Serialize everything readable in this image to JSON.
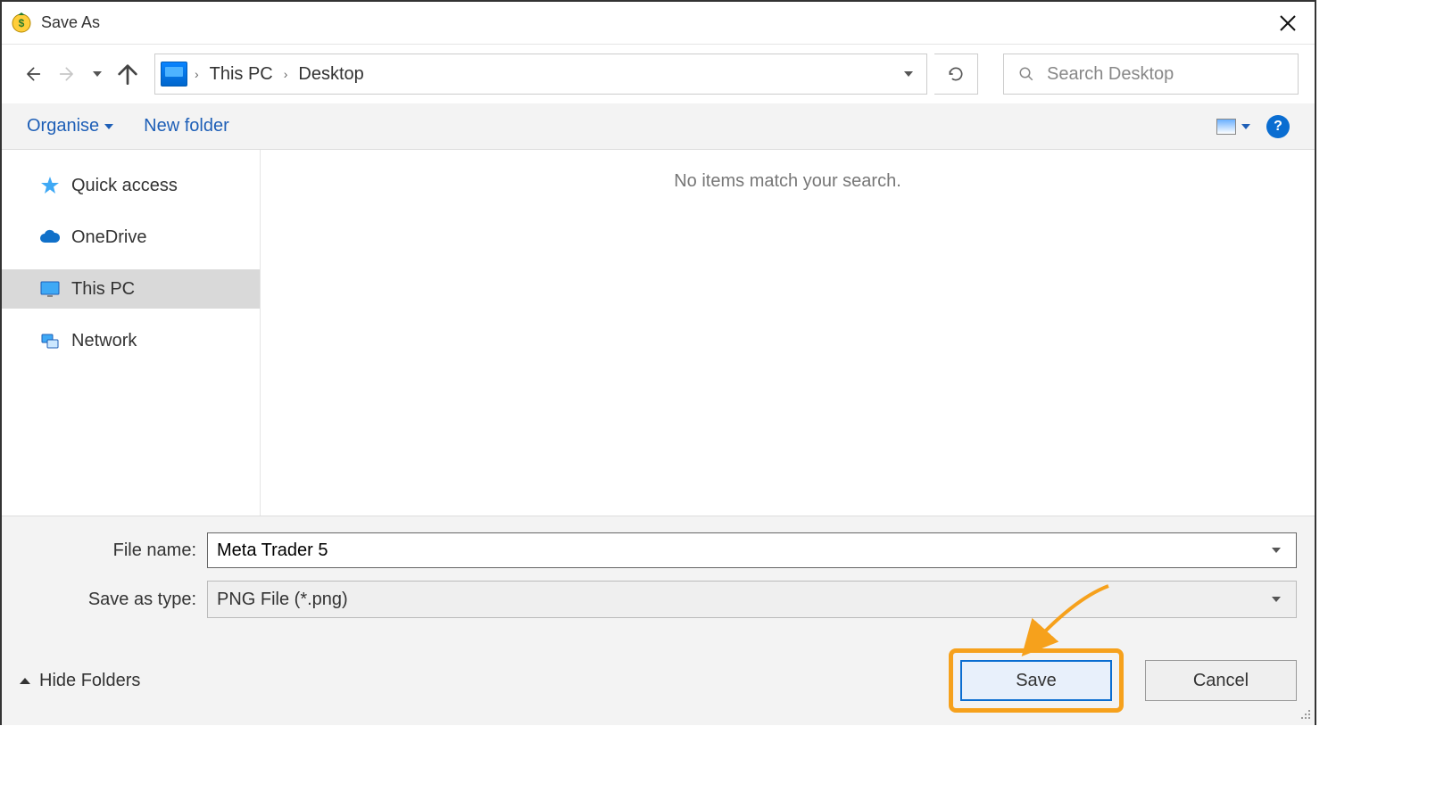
{
  "titlebar": {
    "title": "Save As"
  },
  "navbar": {
    "breadcrumb": [
      "This PC",
      "Desktop"
    ],
    "search_placeholder": "Search Desktop"
  },
  "toolbar": {
    "organise_label": "Organise",
    "newfolder_label": "New folder",
    "help_char": "?"
  },
  "sidebar": {
    "items": [
      {
        "label": "Quick access"
      },
      {
        "label": "OneDrive"
      },
      {
        "label": "This PC"
      },
      {
        "label": "Network"
      }
    ]
  },
  "content": {
    "empty_message": "No items match your search."
  },
  "bottom": {
    "filename_label": "File name:",
    "filename_value": "Meta Trader 5",
    "filetype_label": "Save as type:",
    "filetype_value": "PNG File (*.png)",
    "hide_folders_label": "Hide Folders",
    "save_label": "Save",
    "cancel_label": "Cancel"
  }
}
